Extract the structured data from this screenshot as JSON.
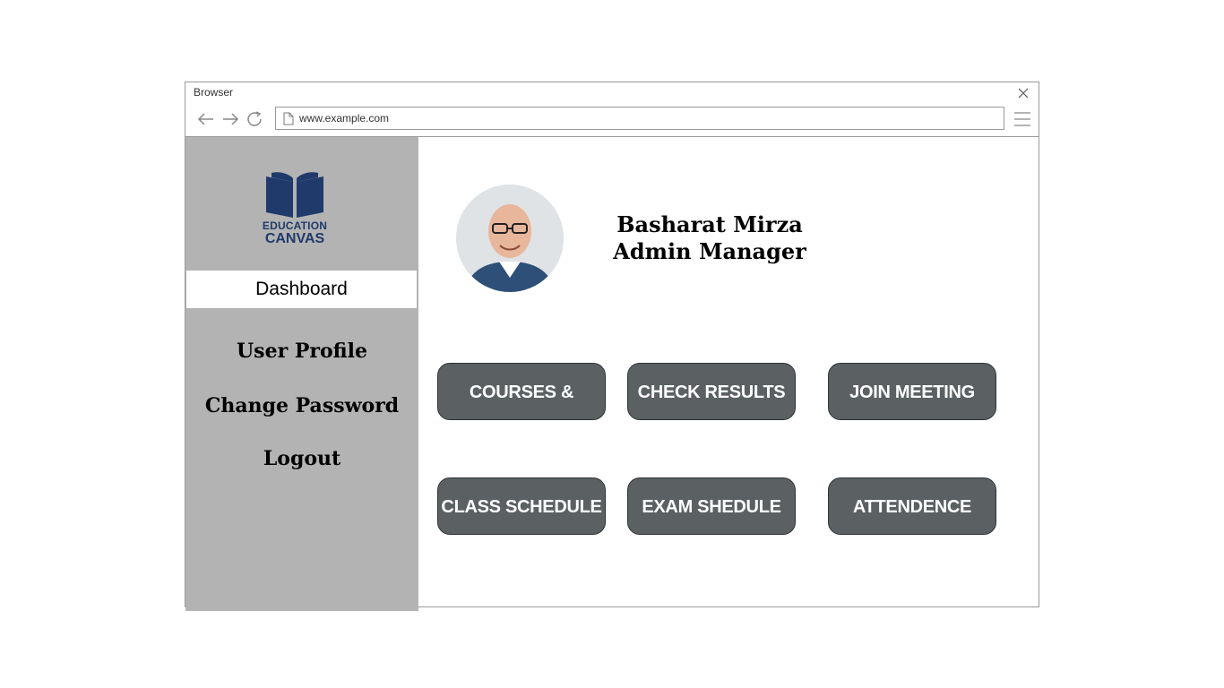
{
  "browser": {
    "title": "Browser",
    "url": "www.example.com"
  },
  "logo": {
    "line1": "EDUCATION",
    "line2": "CANVAS",
    "color": "#1f3a6b"
  },
  "sidebar": {
    "items": [
      {
        "label": "Dashboard",
        "active": true
      },
      {
        "label": "User Profile"
      },
      {
        "label": "Change Password"
      },
      {
        "label": "Logout"
      }
    ],
    "bg": "#b3b3b3"
  },
  "profile": {
    "name": "Basharat Mirza",
    "role": "Admin Manager"
  },
  "tiles": [
    {
      "label": "COURSES & CLASSES"
    },
    {
      "label": "CHECK RESULTS"
    },
    {
      "label": "JOIN MEETING"
    },
    {
      "label": "CLASS SCHEDULE"
    },
    {
      "label": "EXAM SHEDULE"
    },
    {
      "label": "ATTENDENCE"
    }
  ],
  "colors": {
    "tile_bg": "#5b6062",
    "tile_text": "#ffffff"
  },
  "icons": [
    "close-icon",
    "back-arrow-icon",
    "forward-arrow-icon",
    "refresh-icon",
    "document-icon",
    "hamburger-menu-icon",
    "book-logo-icon"
  ]
}
